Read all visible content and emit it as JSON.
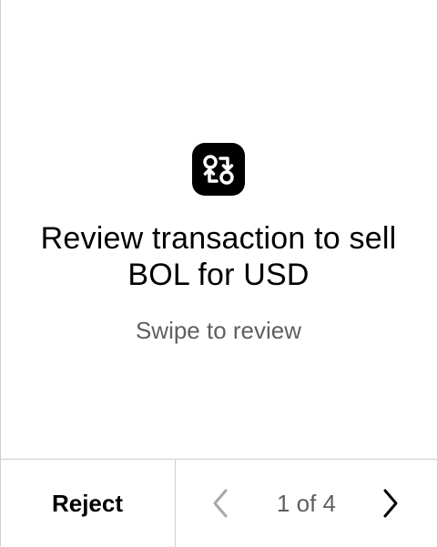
{
  "screen": {
    "icon": "swap-arrows-icon",
    "title": "Review transaction to sell BOL for USD",
    "subtitle": "Swipe to review"
  },
  "footer": {
    "reject_label": "Reject",
    "page_indicator": "1 of 4",
    "prev_icon": "chevron-left-icon",
    "next_icon": "chevron-right-icon"
  },
  "colors": {
    "text_primary": "#000000",
    "text_secondary": "#5f5f5f",
    "disabled": "#a8a8a8",
    "divider": "#cfcfcf"
  }
}
